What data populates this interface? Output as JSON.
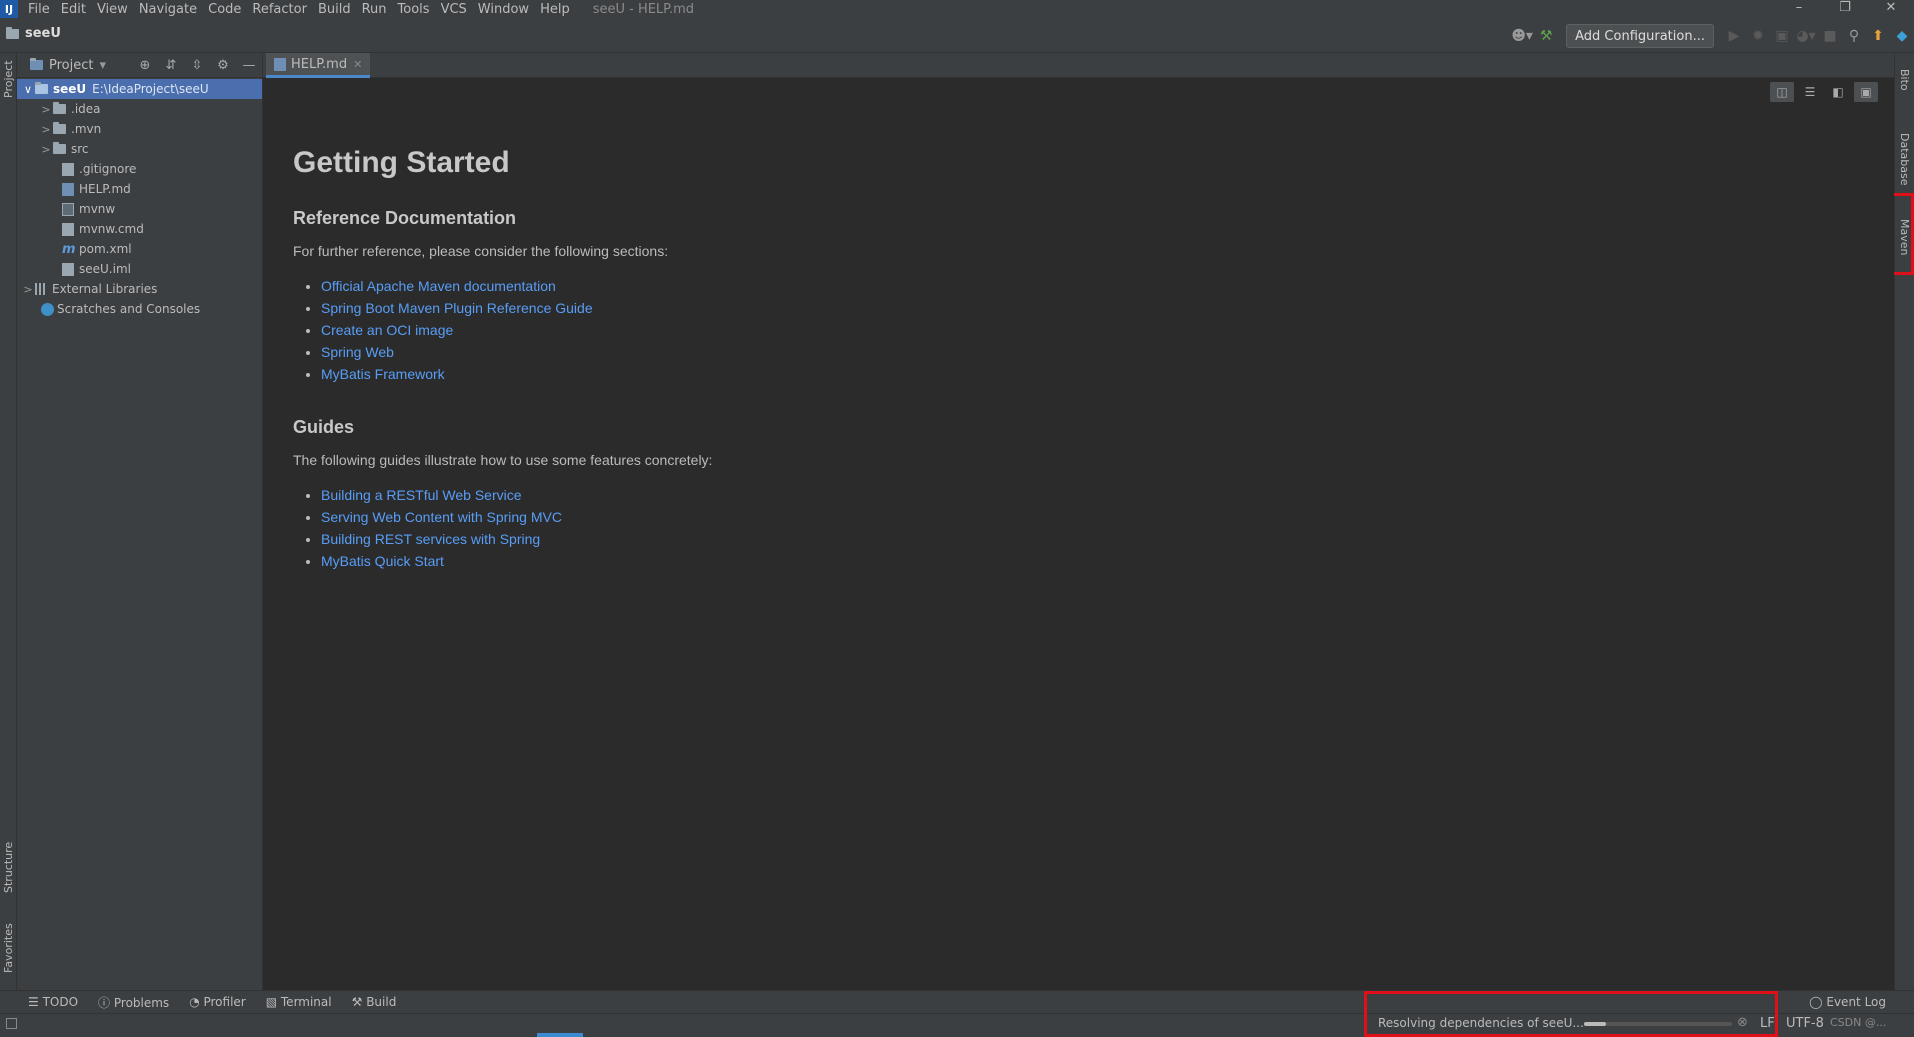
{
  "menu": {
    "logo": "IJ",
    "items": [
      "File",
      "Edit",
      "View",
      "Navigate",
      "Code",
      "Refactor",
      "Build",
      "Run",
      "Tools",
      "VCS",
      "Window",
      "Help"
    ],
    "window_title": "seeU - HELP.md",
    "controls": [
      "–",
      "❐",
      "✕"
    ]
  },
  "navbar": {
    "project_name": "seeU",
    "add_configuration": "Add Configuration..."
  },
  "left_stripe": {
    "project": "Project",
    "structure": "Structure",
    "favorites": "Favorites"
  },
  "right_stripe": {
    "bito": "Bito",
    "database": "Database",
    "maven": "Maven"
  },
  "project_panel": {
    "title": "Project",
    "root": {
      "name": "seeU",
      "path": "E:\\IdeaProject\\seeU"
    },
    "items": [
      {
        "label": ".idea",
        "type": "folder"
      },
      {
        "label": ".mvn",
        "type": "folder"
      },
      {
        "label": "src",
        "type": "folder"
      },
      {
        "label": ".gitignore",
        "type": "file"
      },
      {
        "label": "HELP.md",
        "type": "md"
      },
      {
        "label": "mvnw",
        "type": "term"
      },
      {
        "label": "mvnw.cmd",
        "type": "file"
      },
      {
        "label": "pom.xml",
        "type": "maven"
      },
      {
        "label": "seeU.iml",
        "type": "file"
      }
    ],
    "external_libraries": "External Libraries",
    "scratches": "Scratches and Consoles"
  },
  "editor": {
    "tab_label": "HELP.md",
    "doc": {
      "title": "Getting Started",
      "ref_heading": "Reference Documentation",
      "ref_intro": "For further reference, please consider the following sections:",
      "ref_links": [
        "Official Apache Maven documentation",
        "Spring Boot Maven Plugin Reference Guide",
        "Create an OCI image",
        "Spring Web",
        "MyBatis Framework"
      ],
      "guides_heading": "Guides",
      "guides_intro": "The following guides illustrate how to use some features concretely:",
      "guide_links": [
        "Building a RESTful Web Service",
        "Serving Web Content with Spring MVC",
        "Building REST services with Spring",
        "MyBatis Quick Start"
      ]
    }
  },
  "tool_windows": [
    "TODO",
    "Problems",
    "Profiler",
    "Terminal",
    "Build"
  ],
  "event_log": "Event Log",
  "status": {
    "progress_text": "Resolving dependencies of seeU...",
    "progress": 0.15,
    "line_separator": "LF",
    "encoding": "UTF-8",
    "watermark": "CSDN @..."
  },
  "colors": {
    "highlight": "#e0101a",
    "link": "#589df6",
    "selection": "#4b6eaf"
  }
}
